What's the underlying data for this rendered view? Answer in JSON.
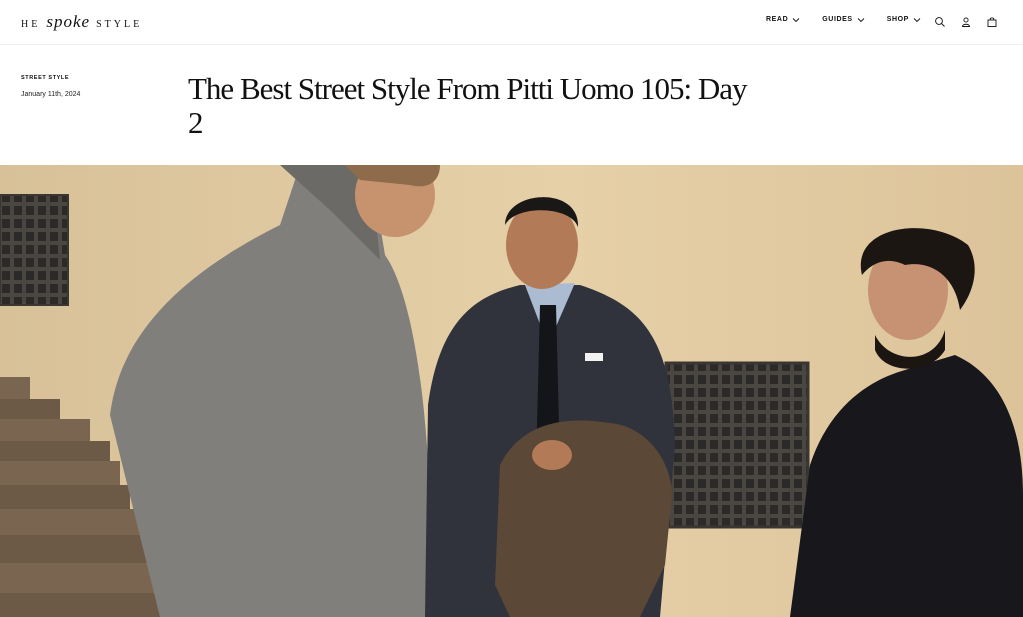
{
  "brand": {
    "prefix": "HE",
    "middle": "spoke",
    "suffix": "STYLE"
  },
  "nav": [
    {
      "label": "READ"
    },
    {
      "label": "GUIDES"
    },
    {
      "label": "SHOP"
    }
  ],
  "icons": [
    "search-icon",
    "account-icon",
    "bag-icon"
  ],
  "article": {
    "category": "STREET STYLE",
    "date": "January 11th, 2024",
    "title": "The Best Street Style From Pitti Uomo 105: Day 2"
  },
  "colors": {
    "wall": "#e0c9a0",
    "coat_grey": "#7f7e7b",
    "suit_navy": "#2f323a",
    "coat_black": "#16161b",
    "jacket_olive": "#5a4734"
  }
}
